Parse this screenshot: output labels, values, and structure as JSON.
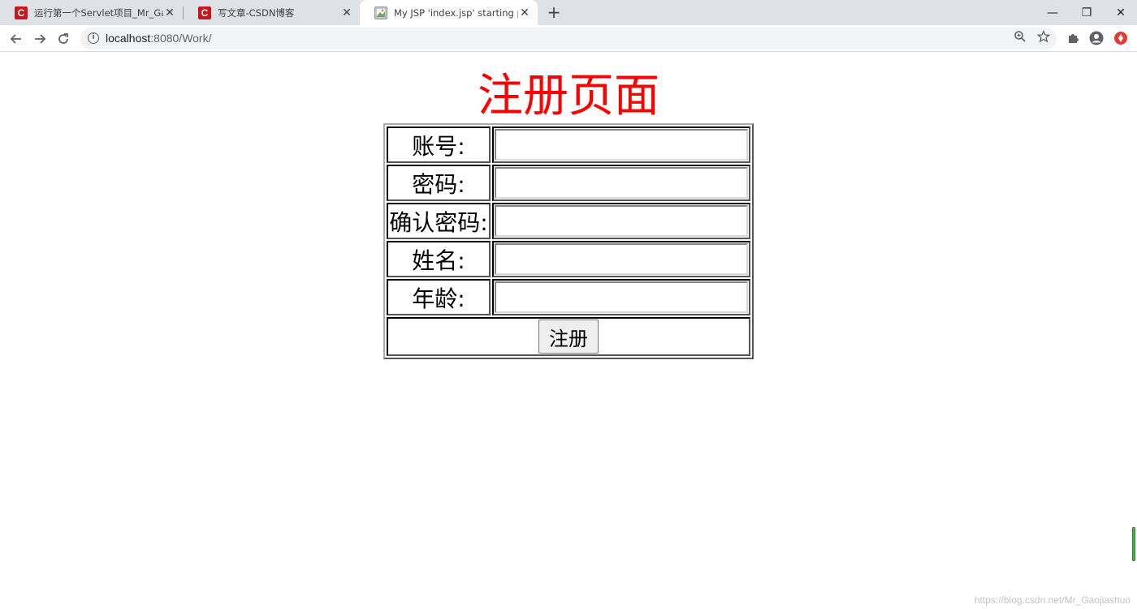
{
  "browser": {
    "tabs": [
      {
        "title": "运行第一个Servlet项目_Mr_Gao"
      },
      {
        "title": "写文章-CSDN博客"
      },
      {
        "title": "My JSP 'index.jsp' starting pag"
      }
    ],
    "favicon_letter": "C",
    "url": {
      "host": "localhost",
      "path": ":8080/Work/"
    },
    "controls": {
      "minimize": "—",
      "restore": "❐",
      "close": "✕"
    }
  },
  "page": {
    "heading": "注册页面",
    "fields": [
      {
        "label": "账号:",
        "value": ""
      },
      {
        "label": "密码:",
        "value": ""
      },
      {
        "label": "确认密码:",
        "value": ""
      },
      {
        "label": "姓名:",
        "value": ""
      },
      {
        "label": "年龄:",
        "value": ""
      }
    ],
    "submit_label": "注册"
  },
  "watermark": "https://blog.csdn.net/Mr_Gaojiashuo",
  "colors": {
    "heading": "#ff0000",
    "tabstrip": "#dee1e6",
    "csdn_red": "#c8161d"
  }
}
